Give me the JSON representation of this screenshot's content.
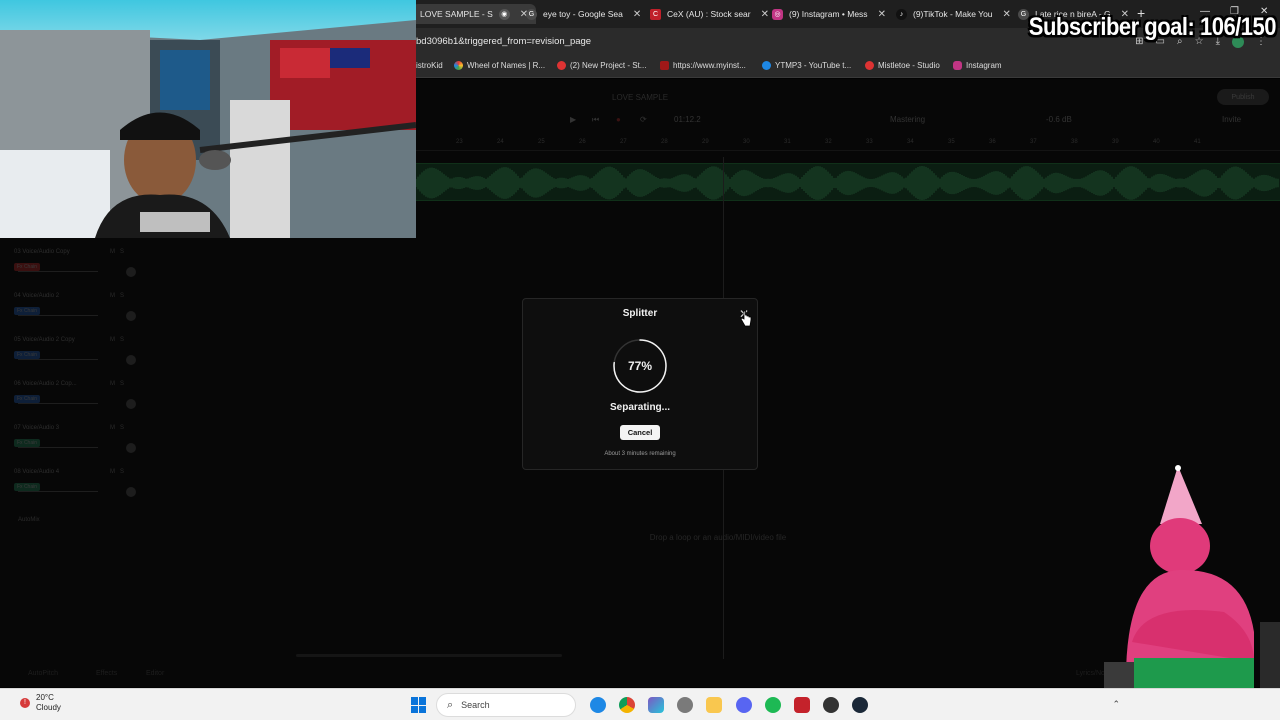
{
  "browser": {
    "tabs": [
      {
        "label": "LOVE SAMPLE - S",
        "active": true,
        "icon": "recording-icon"
      },
      {
        "label": "eye toy - Google Sea",
        "icon": "google-icon"
      },
      {
        "label": "CeX (AU) : Stock sear",
        "icon": "cex-icon"
      },
      {
        "label": "(9) Instagram • Mess",
        "icon": "instagram-icon"
      },
      {
        "label": "(9)TikTok - Make You",
        "icon": "tiktok-icon"
      },
      {
        "label": "I ate rice n bireA - G",
        "icon": "google-icon"
      }
    ],
    "new_tab": "+",
    "url": "bd3096b1&triggered_from=revision_page",
    "bookmarks": [
      {
        "label": "istroKid"
      },
      {
        "label": "Wheel of Names | R..."
      },
      {
        "label": "(2) New Project - St..."
      },
      {
        "label": "https://www.myinst..."
      },
      {
        "label": "YTMP3 - YouTube t..."
      },
      {
        "label": "Mistletoe - Studio"
      },
      {
        "label": "Instagram"
      }
    ]
  },
  "overlay": {
    "subscriber_goal": "Subscriber goal: 106/150"
  },
  "daw": {
    "project_title": "LOVE SAMPLE",
    "time": "01:12.2",
    "mastering_label": "Mastering",
    "db": "-0.6 dB",
    "invite": "Invite",
    "publish": "Publish",
    "ruler": [
      "23",
      "24",
      "25",
      "26",
      "27",
      "28",
      "29",
      "30",
      "31",
      "32",
      "33",
      "34",
      "35",
      "36",
      "37",
      "38",
      "39",
      "40",
      "41"
    ],
    "tracks": [
      {
        "name": "03 Voice/Audio Copy",
        "badge": "Fx Chain",
        "color": "#3a1010"
      },
      {
        "name": "04 Voice/Audio 2",
        "badge": "Fx Chain",
        "color": "#0e1f38"
      },
      {
        "name": "05 Voice/Audio 2 Copy",
        "badge": "Fx Chain",
        "color": "#0e1f38"
      },
      {
        "name": "06 Voice/Audio 2 Cop...",
        "badge": "Fx Chain",
        "color": "#0e1f38"
      },
      {
        "name": "07 Voice/Audio 3",
        "badge": "Fx Chain",
        "color": "#0e2a1e"
      },
      {
        "name": "08 Voice/Audio 4",
        "badge": "Fx Chain",
        "color": "#0e2a1e"
      }
    ],
    "automix": "AutoMix",
    "drop_hint": "Drop a loop or an audio/MIDI/video file",
    "bottom_tools": [
      "AutoPitch",
      "Effects",
      "Editor"
    ],
    "bottom_right": "Lyrics/Notes"
  },
  "modal": {
    "title": "Splitter",
    "progress": 77,
    "progress_text": "77%",
    "status": "Separating...",
    "cancel": "Cancel",
    "remaining": "About 3 minutes remaining"
  },
  "taskbar": {
    "weather_temp": "20°C",
    "weather_desc": "Cloudy",
    "search": "Search"
  }
}
